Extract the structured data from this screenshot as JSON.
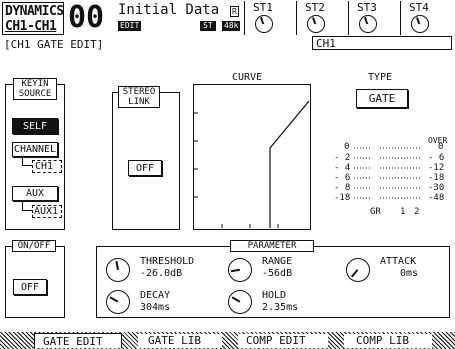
{
  "header": {
    "title_line1": "DYNAMICS",
    "title_line2": "CH1-CH1",
    "scene_number": "00",
    "scene_name": "Initial Data",
    "edit_badge": "EDIT",
    "st_badge": "ST",
    "rate_badge": "48k",
    "r_badge": "R",
    "st_knobs": [
      {
        "label": "ST1"
      },
      {
        "label": "ST2"
      },
      {
        "label": "ST3"
      },
      {
        "label": "ST4"
      }
    ]
  },
  "subheader": {
    "page_title": "[CH1 GATE EDIT]",
    "channel": "CH1"
  },
  "keyin_source": {
    "title_line1": "KEYIN",
    "title_line2": "SOURCE",
    "self_button": "SELF",
    "channel_button": "CHANNEL",
    "channel_value": "CH1",
    "aux_button": "AUX",
    "aux_value": "AUX1"
  },
  "stereo_link": {
    "title_line1": "STEREO",
    "title_line2": "LINK",
    "button": "OFF"
  },
  "curve": {
    "label": "CURVE"
  },
  "type": {
    "label": "TYPE",
    "value": "GATE"
  },
  "meter": {
    "over_label": "OVER",
    "left_scale": [
      "0",
      "- 2",
      "- 4",
      "- 6",
      "- 8",
      "-18"
    ],
    "right_scale": [
      "0",
      "- 6",
      "-12",
      "-18",
      "-30",
      "-48"
    ],
    "bottom_labels": {
      "gr": "GR",
      "ch1": "1",
      "ch2": "2"
    }
  },
  "on_off": {
    "title": "ON/OFF",
    "button": "OFF"
  },
  "parameter": {
    "title": "PARAMETER",
    "threshold": {
      "label": "THRESHOLD",
      "value": "-26.0dB"
    },
    "range": {
      "label": "RANGE",
      "value": "-56dB"
    },
    "attack": {
      "label": "ATTACK",
      "value": "0ms"
    },
    "decay": {
      "label": "DECAY",
      "value": "304ms"
    },
    "hold": {
      "label": "HOLD",
      "value": "2.35ms"
    }
  },
  "tabs": [
    {
      "label": "GATE EDIT"
    },
    {
      "label": "GATE LIB"
    },
    {
      "label": "COMP EDIT"
    },
    {
      "label": "COMP LIB"
    }
  ]
}
